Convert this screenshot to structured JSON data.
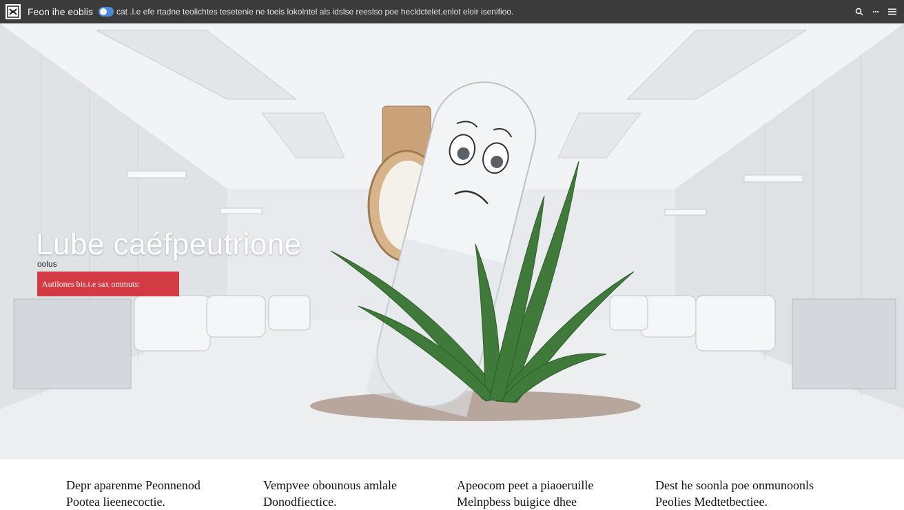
{
  "header": {
    "site_name": "Feon ihe eoblis",
    "ticker": "cat .l.e efe rtadne teolichtes tesetenie ne toeis lokolntel als idslse reeslso poe hecldctelet.enlot eloir isenifioo."
  },
  "hero": {
    "title": "Lube caéfpeutrione",
    "subtitle": "oolus",
    "cta_label": "Autilones bis.t.e sax ommuts:"
  },
  "features": [
    {
      "line1": "Depr aparenme Peonnenod",
      "line2": "Pootea lieenecoctie."
    },
    {
      "line1": "Vempvee obounous amlale",
      "line2": "Donodfiectice."
    },
    {
      "line1": "Apeocom peet a piaoeruille",
      "line2": "Melnpbess buigice dhee"
    },
    {
      "line1": "Dest he soonla poe onmunoonls",
      "line2": "Peolies Medtetbectiee."
    }
  ],
  "icons": {
    "logo": "logo-mark",
    "toggle": "toggle-switch",
    "search": "search-icon",
    "more": "more-dots-icon",
    "menu": "hamburger-menu-icon"
  },
  "colors": {
    "topbar": "#3b3b3b",
    "accent": "#d23a44",
    "toggle": "#4c8bd6"
  }
}
